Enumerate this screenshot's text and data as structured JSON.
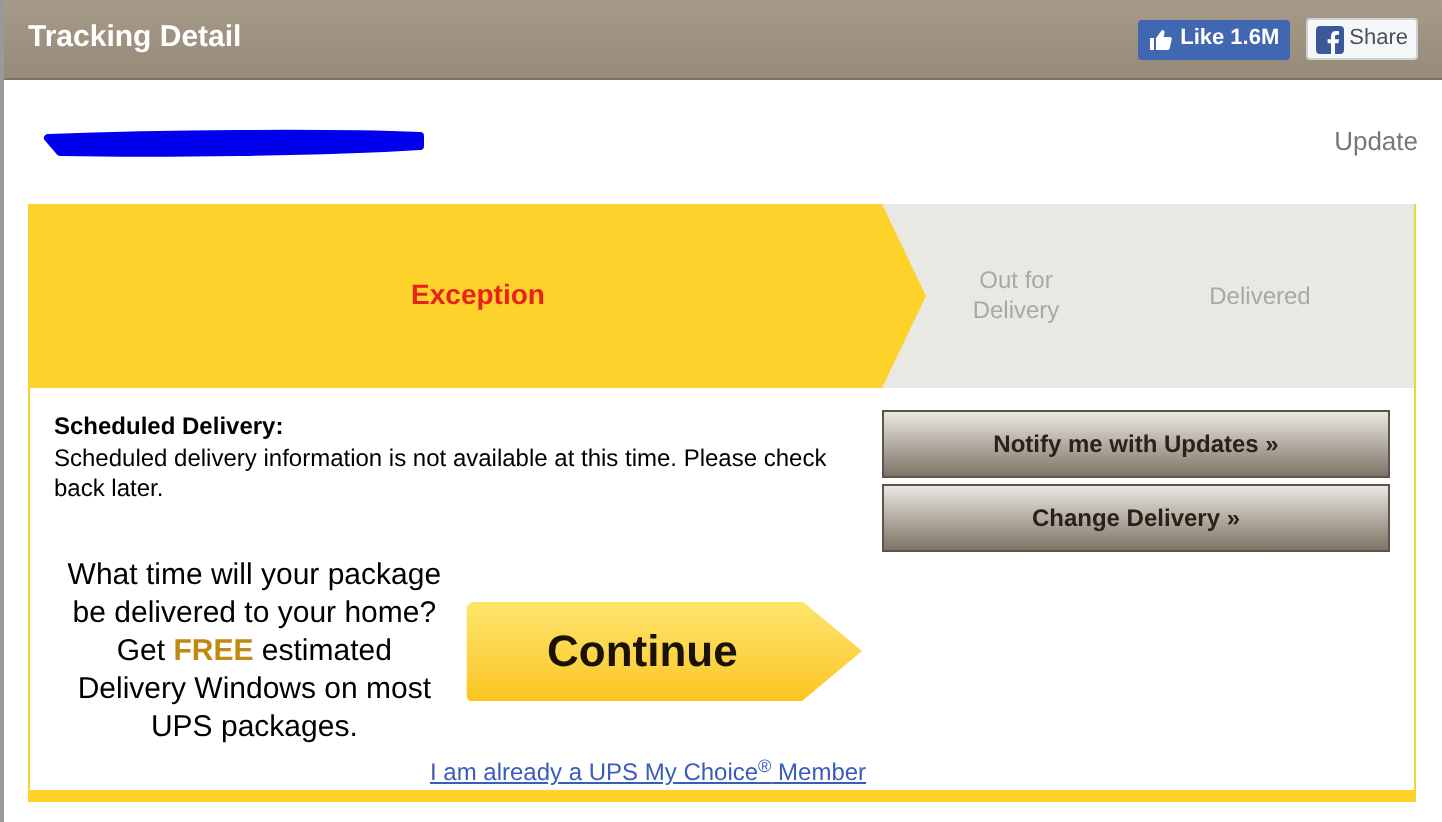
{
  "header": {
    "title": "Tracking Detail",
    "like_button": "Like 1.6M",
    "share_button": "Share"
  },
  "updated_label": "Update",
  "steps": [
    {
      "label": "Exception",
      "selected": true
    },
    {
      "label": "Out for Delivery",
      "selected": false
    },
    {
      "label": "Delivered",
      "selected": false
    }
  ],
  "scheduled": {
    "heading": "Scheduled Delivery:",
    "text": "Scheduled delivery information is not available at this time. Please check back later."
  },
  "actions": [
    "Notify me with Updates »",
    "Change Delivery »"
  ],
  "promo": {
    "text": "What time will your package be delivered to your home? Get **FREE** estimated Delivery Windows on most UPS packages.",
    "button": "Continue",
    "link": "I am already a UPS My Choice$^{®}$ Member"
  }
}
